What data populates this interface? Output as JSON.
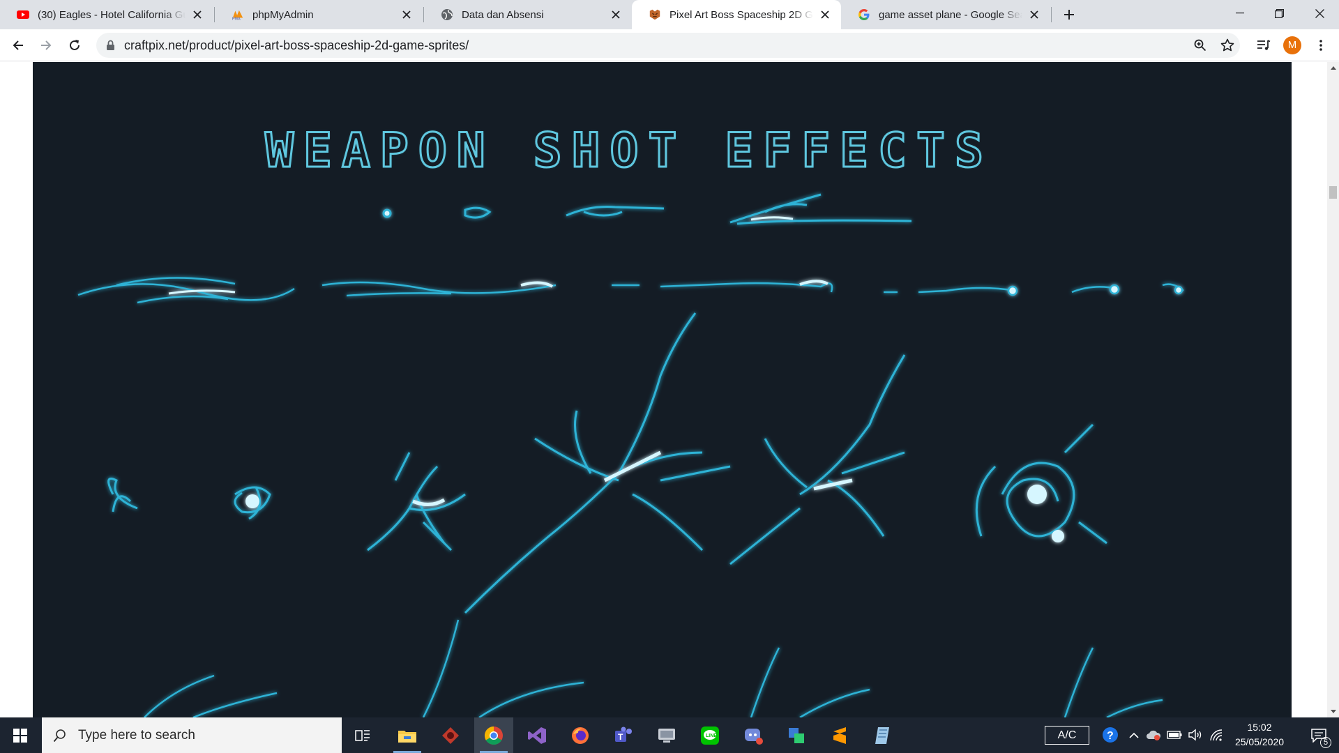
{
  "browser": {
    "tabs": [
      {
        "title": "(30) Eagles - Hotel California Gui",
        "icon": "youtube-icon",
        "active": false
      },
      {
        "title": "phpMyAdmin",
        "icon": "phpmyadmin-icon",
        "active": false
      },
      {
        "title": "Data dan Absensi",
        "icon": "globe-icon",
        "active": false
      },
      {
        "title": "Pixel Art Boss Spaceship 2D Gam",
        "icon": "craftpix-icon",
        "active": true
      },
      {
        "title": "game asset plane - Google Searc",
        "icon": "google-icon",
        "active": false
      }
    ],
    "url": "craftpix.net/product/pixel-art-boss-spaceship-2d-game-sprites/",
    "profile_initial": "M",
    "colors": {
      "tabstrip": "#dee1e6",
      "omnibox": "#f1f3f4",
      "avatar": "#e8710a"
    }
  },
  "page": {
    "heading": "WEAPON SHOT EFFECTS",
    "colors": {
      "background": "#141c25",
      "effect": "#2fb3d6",
      "glow": "#d6f6ff"
    }
  },
  "taskbar": {
    "search_placeholder": "Type here to search",
    "apps": [
      "task-view",
      "file-explorer",
      "app-red",
      "chrome",
      "visual-studio",
      "firefox",
      "teams",
      "app-gray",
      "line",
      "app-discord",
      "app-green",
      "sublime-text",
      "app-blue"
    ],
    "ac_label": "A/C",
    "time": "15:02",
    "date": "25/05/2020",
    "notification_count": "5"
  }
}
